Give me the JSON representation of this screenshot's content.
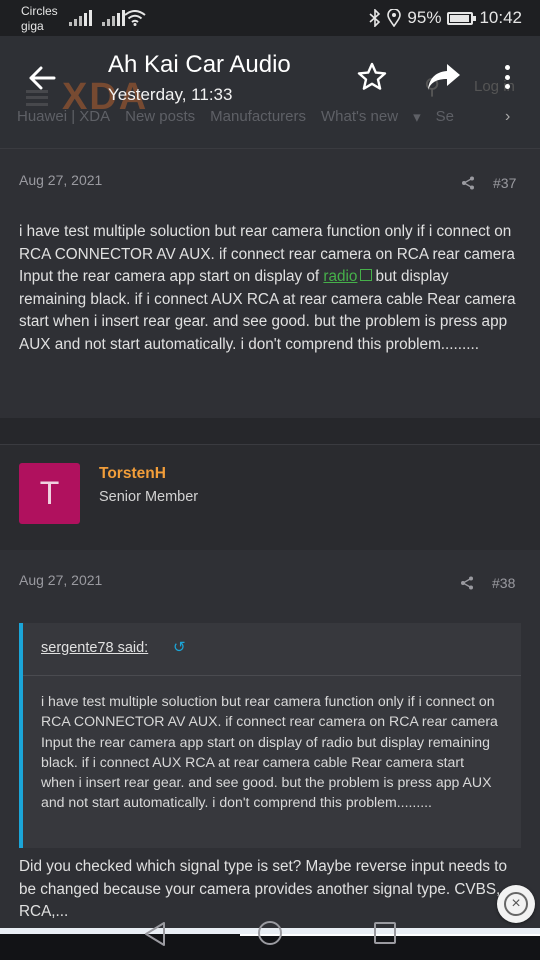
{
  "status_bar": {
    "carrier_line1": "Circles",
    "carrier_line2": "giga",
    "battery": "95%",
    "battery_level": 0.95,
    "time": "10:42"
  },
  "app_bar": {
    "title": "Ah Kai Car Audio",
    "subtitle": "Yesterday, 11:33",
    "background_logo": "XDA",
    "background_login": "Log in",
    "nav_items": [
      "Huawei | XDA",
      "New posts",
      "Manufacturers",
      "What's new",
      "Se"
    ]
  },
  "posts": [
    {
      "date": "Aug 27, 2021",
      "number": "#37",
      "body_before_link": "i have test multiple soluction but rear camera function only if i connect on RCA CONNECTOR AV AUX. if connect rear camera on RCA rear camera Input the rear camera app start on display of ",
      "link_text": "radio",
      "body_after_link": "but display remaining black. if i connect AUX RCA at rear camera cable Rear camera start when i insert rear gear. and see good. but the problem is press app AUX and not start automatically. i don't comprend this problem........."
    },
    {
      "author": {
        "initial": "T",
        "name": "TorstenH",
        "role": "Senior Member",
        "avatar_color": "#b0115e"
      },
      "date": "Aug 27, 2021",
      "number": "#38",
      "quote": {
        "header": "sergente78 said:",
        "text": "i have test multiple soluction but rear camera function only if i connect on RCA CONNECTOR AV AUX. if connect rear camera on RCA rear camera Input the rear camera app start on display of radio but display remaining black. if i connect AUX RCA at rear camera cable Rear camera start when i insert rear gear. and see good. but the problem is press app AUX and not start automatically. i don't comprend this problem........."
      },
      "body": "Did you checked which signal type is set? Maybe reverse input needs to be changed because your camera provides another signal type. CVBS, RCA,..."
    }
  ],
  "colors": {
    "accent_link": "#46b04a",
    "author_name": "#f29e3a",
    "quote_bar": "#1ba5d8",
    "background": "#26272b"
  },
  "icons": {
    "back": "arrow-left-icon",
    "star": "star-icon",
    "share": "share-arrow-icon",
    "more": "more-vertical-icon",
    "close": "close-circle-icon"
  }
}
